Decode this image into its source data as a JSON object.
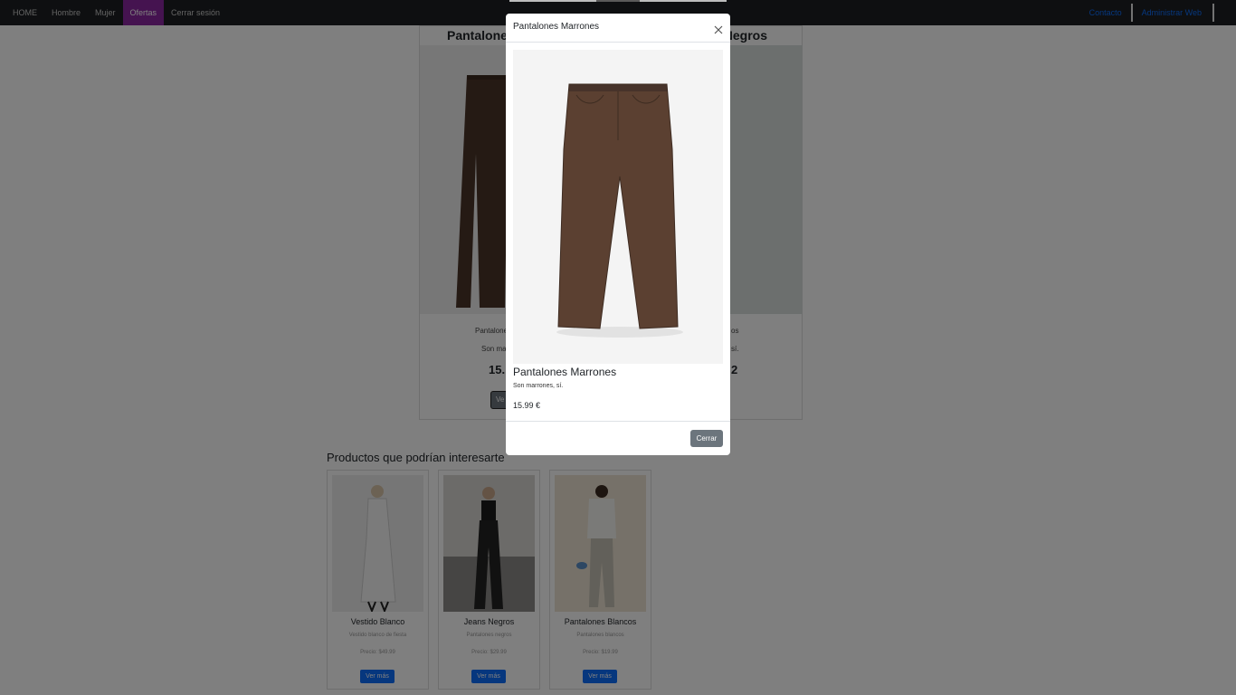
{
  "nav": {
    "items": [
      {
        "label": "HOME"
      },
      {
        "label": "Hombre"
      },
      {
        "label": "Mujer"
      },
      {
        "label": "Ofertas"
      },
      {
        "label": "Cerrar sesión"
      }
    ],
    "right": {
      "contact": "Contacto",
      "admin": "Administrar Web"
    }
  },
  "product": {
    "title_left": "Pantalone",
    "title_right": "Negros",
    "text_left_1": "Pantalone",
    "text_left_2": "Son ma",
    "price_left": "15.",
    "button_left": "Ve",
    "text_right_1": "os",
    "text_right_2": "sí.",
    "price_right": "2"
  },
  "recommendations": {
    "title": "Productos que podrían interesarte",
    "items": [
      {
        "name": "Vestido Blanco",
        "desc": "Vestido blanco de fiesta",
        "price": "Precio: $49.99",
        "button": "Ver más"
      },
      {
        "name": "Jeans Negros",
        "desc": "Pantalones negros",
        "price": "Precio: $29.99",
        "button": "Ver más"
      },
      {
        "name": "Pantalones Blancos",
        "desc": "Pantalones blancos",
        "price": "Precio: $19.99",
        "button": "Ver más"
      }
    ]
  },
  "modal": {
    "title": "Pantalones Marrones",
    "name": "Pantalones Marrones",
    "desc": "Son marrones, sí.",
    "price": "15.99 €",
    "close_button": "Cerrar"
  },
  "colors": {
    "navbar": "#1c1f22",
    "active_tab": "#8a26a0",
    "link": "#0d6efd",
    "button_primary": "#0d6efd",
    "button_secondary": "#6c757d"
  }
}
